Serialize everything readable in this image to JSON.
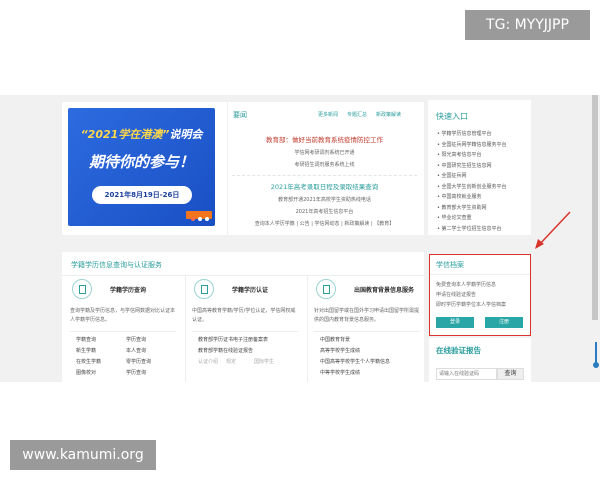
{
  "overlay": {
    "tg": "TG: MYYJJPP",
    "watermark": "www.kamumi.org"
  },
  "banner": {
    "line1_quote": "“2021学在港澳”",
    "line1_rest": "说明会",
    "line2": "期待你的参与！",
    "date": "2021年8月19日-26日"
  },
  "news": {
    "title": "要闻",
    "links": [
      "更多新闻",
      "专题汇总",
      "新政策解读"
    ],
    "headline1": "教育部：做好当前教育系统疫情防控工作",
    "sub1": [
      "学信网考研调剂系统已开通",
      "考研招生调剂服务系统上线"
    ],
    "headline2": "2021年高考录取日程及录取结果查询",
    "sub2": [
      "教育部开通2021年高校学生资助热线电话",
      "2021年高考招生信息平台"
    ],
    "footer": "查询本人学历学籍 | 公告 | 学信网动态 | 新政策解读 | 【教育】"
  },
  "quick": {
    "title": "快速入口",
    "items": [
      "学籍学历信息管理平台",
      "全国征兵网学籍信息服务平台",
      "阳光高考信息平台",
      "中国研究生招生信息网",
      "全国征兵网",
      "全国大学生创新创业服务平台",
      "中国高校就业服务",
      "教育部大学生资助网",
      "毕业论文查重",
      "第二学士学位招生信息平台"
    ]
  },
  "services": {
    "title": "学籍学历信息查询与认证服务",
    "cols": [
      {
        "title": "学籍学历查询",
        "desc": "查询学籍及学历信息，与学信网数据对比认证本人学籍学历信息。",
        "links": [
          "学籍查询",
          "学历查询",
          "新生学籍",
          "本人查询",
          "在校生学籍",
          "零学历查询",
          "图像校对",
          "学历查询"
        ]
      },
      {
        "title": "学籍学历认证",
        "desc": "中国高等教育学籍/学历/学位认证，学信网权威认证。",
        "links": [
          "教育部学历证书电子注册备案表",
          "教育部学籍在线验证报告",
          "认证介绍",
          "规定",
          "国际学生"
        ]
      },
      {
        "title": "出国教育背景信息服务",
        "desc": "针对出国留学或在国外学习申请出国留学所需提供的国内教育背景信息服务。",
        "links": [
          "中国教育背景",
          "高等学校学生成绩",
          "中国高等学校学生个人学籍信息",
          "中等学校学生成绩"
        ]
      }
    ]
  },
  "xinxi": {
    "title": "学信档案",
    "lines": [
      "免费查询本人学籍学历信息",
      "申请在线验证报告",
      "即时学历学籍学位本人学信档案"
    ],
    "login": "登录",
    "register": "注册"
  },
  "verify": {
    "title": "在线验证报告",
    "placeholder": "请输入在线验证码",
    "query": "查询"
  }
}
